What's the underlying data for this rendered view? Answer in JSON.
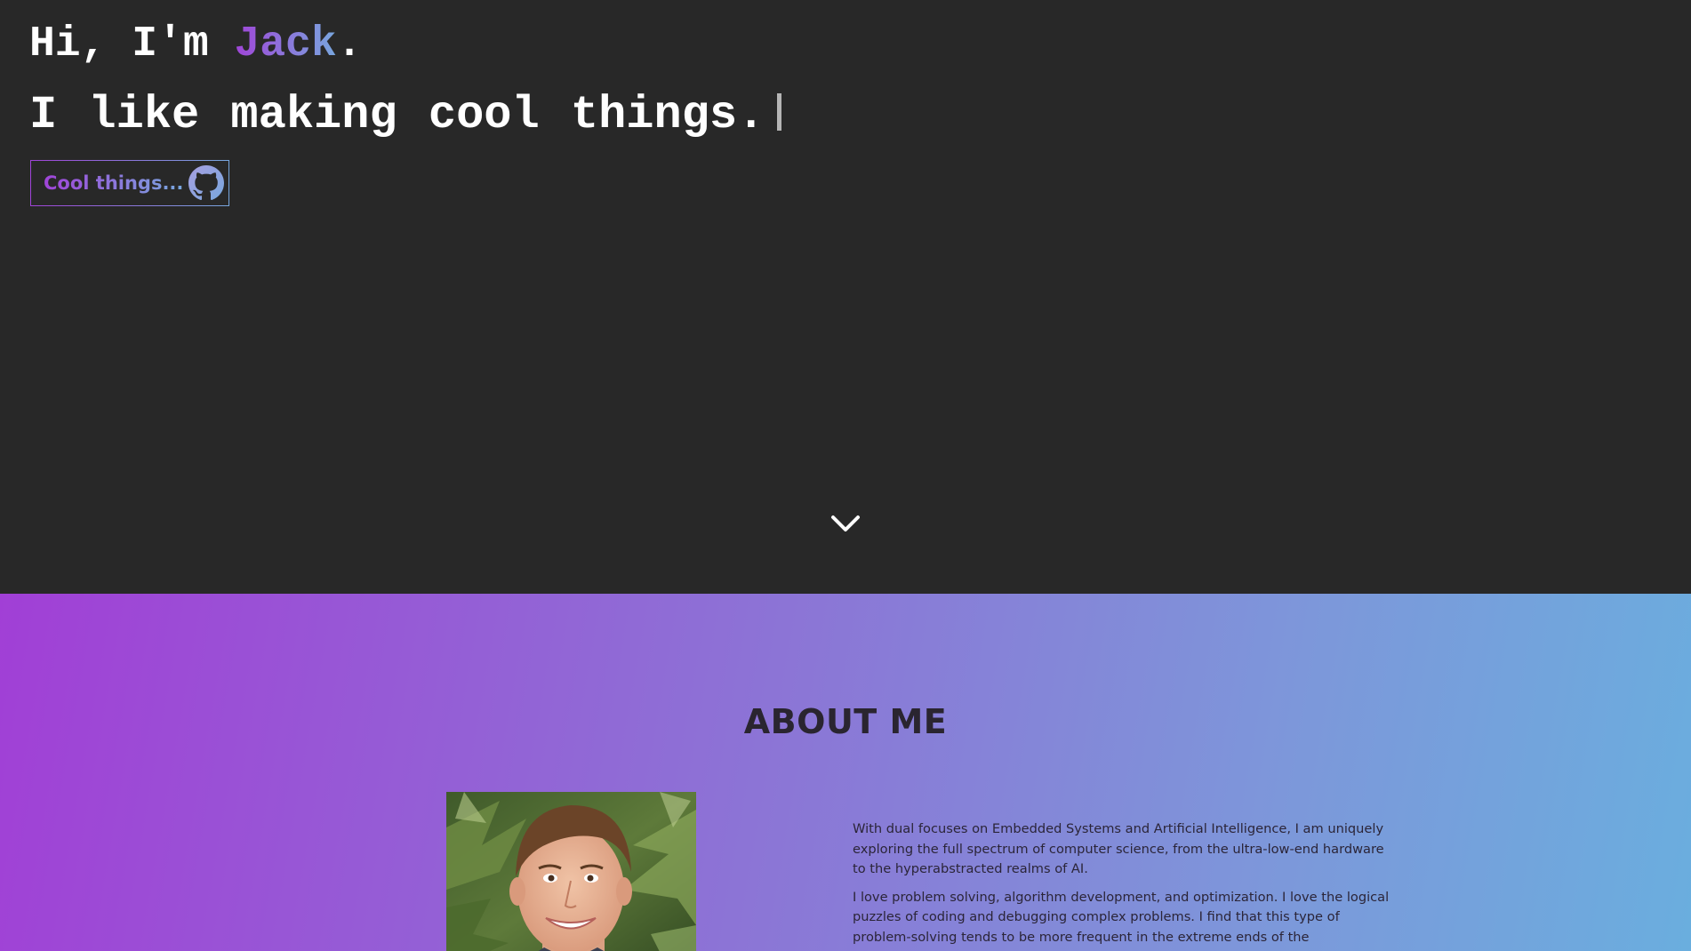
{
  "hero": {
    "greeting_prefix": "Hi, I'm ",
    "name": "Jack",
    "greeting_suffix": ".",
    "tagline": "I like making cool things.",
    "cool_button_label": "Cool things...",
    "github_icon": "github-icon",
    "scroll_icon": "chevron-down-icon"
  },
  "about": {
    "title": "ABOUT ME",
    "portrait": "portrait-photo",
    "paragraphs": [
      "With dual focuses on Embedded Systems and Artificial Intelligence, I am uniquely exploring the full spectrum of computer science, from the ultra-low-end hardware to the hyperabstracted realms of AI.",
      "I love problem solving, algorithm development, and optimization. I love the logical puzzles of coding and debugging complex problems. I find that this type of problem-solving tends to be more frequent in the extreme ends of the"
    ]
  },
  "colors": {
    "background": "#282828",
    "accent_start": "#a044d8",
    "accent_end": "#78a7de",
    "about_text": "#2b2538"
  }
}
